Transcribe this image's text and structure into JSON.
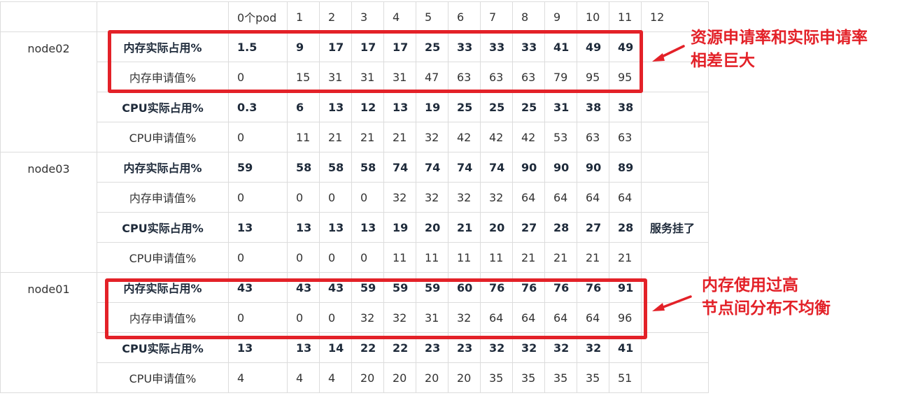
{
  "header": [
    "0个pod",
    "1",
    "2",
    "3",
    "4",
    "5",
    "6",
    "7",
    "8",
    "9",
    "10",
    "11",
    "12"
  ],
  "nodes": [
    {
      "name": "node02",
      "rows": [
        {
          "label": "内存实际占用%",
          "bold": true,
          "values": [
            "1.5",
            "9",
            "17",
            "17",
            "17",
            "25",
            "33",
            "33",
            "33",
            "41",
            "49",
            "49"
          ],
          "status": ""
        },
        {
          "label": "内存申请值%",
          "bold": false,
          "values": [
            "0",
            "15",
            "31",
            "31",
            "31",
            "47",
            "63",
            "63",
            "63",
            "79",
            "95",
            "95"
          ],
          "status": ""
        },
        {
          "label": "CPU实际占用%",
          "bold": true,
          "values": [
            "0.3",
            "6",
            "13",
            "12",
            "13",
            "19",
            "25",
            "25",
            "25",
            "31",
            "38",
            "38"
          ],
          "status": ""
        },
        {
          "label": "CPU申请值%",
          "bold": false,
          "values": [
            "0",
            "11",
            "21",
            "21",
            "21",
            "32",
            "42",
            "42",
            "42",
            "53",
            "63",
            "63"
          ],
          "status": ""
        }
      ]
    },
    {
      "name": "node03",
      "rows": [
        {
          "label": "内存实际占用%",
          "bold": true,
          "values": [
            "59",
            "58",
            "58",
            "58",
            "74",
            "74",
            "74",
            "74",
            "90",
            "90",
            "90",
            "89"
          ],
          "status": ""
        },
        {
          "label": "内存申请值%",
          "bold": false,
          "values": [
            "0",
            "0",
            "0",
            "0",
            "32",
            "32",
            "32",
            "32",
            "64",
            "64",
            "64",
            "64"
          ],
          "status": ""
        },
        {
          "label": "CPU实际占用%",
          "bold": true,
          "values": [
            "13",
            "13",
            "13",
            "13",
            "19",
            "20",
            "21",
            "20",
            "27",
            "28",
            "27",
            "28"
          ],
          "status": "服务挂了"
        },
        {
          "label": "CPU申请值%",
          "bold": false,
          "values": [
            "0",
            "0",
            "0",
            "0",
            "11",
            "11",
            "11",
            "11",
            "21",
            "21",
            "21",
            "21"
          ],
          "status": ""
        }
      ]
    },
    {
      "name": "node01",
      "rows": [
        {
          "label": "内存实际占用%",
          "bold": true,
          "values": [
            "43",
            "43",
            "43",
            "59",
            "59",
            "59",
            "60",
            "76",
            "76",
            "76",
            "76",
            "91"
          ],
          "status": ""
        },
        {
          "label": "内存申请值%",
          "bold": false,
          "values": [
            "0",
            "0",
            "0",
            "32",
            "32",
            "31",
            "32",
            "64",
            "64",
            "64",
            "64",
            "96"
          ],
          "status": ""
        },
        {
          "label": "CPU实际占用%",
          "bold": true,
          "values": [
            "13",
            "13",
            "14",
            "22",
            "22",
            "23",
            "23",
            "32",
            "32",
            "32",
            "32",
            "41"
          ],
          "status": ""
        },
        {
          "label": "CPU申请值%",
          "bold": false,
          "values": [
            "4",
            "4",
            "4",
            "20",
            "20",
            "20",
            "20",
            "35",
            "35",
            "35",
            "35",
            "51"
          ],
          "status": ""
        }
      ]
    }
  ],
  "annotations": {
    "top": [
      "资源申请率和实际申请率",
      "相差巨大"
    ],
    "bottom": [
      "内存使用过高",
      "节点间分布不均衡"
    ]
  },
  "colors": {
    "highlight": "#e32128",
    "grid": "#dcdcdc"
  }
}
